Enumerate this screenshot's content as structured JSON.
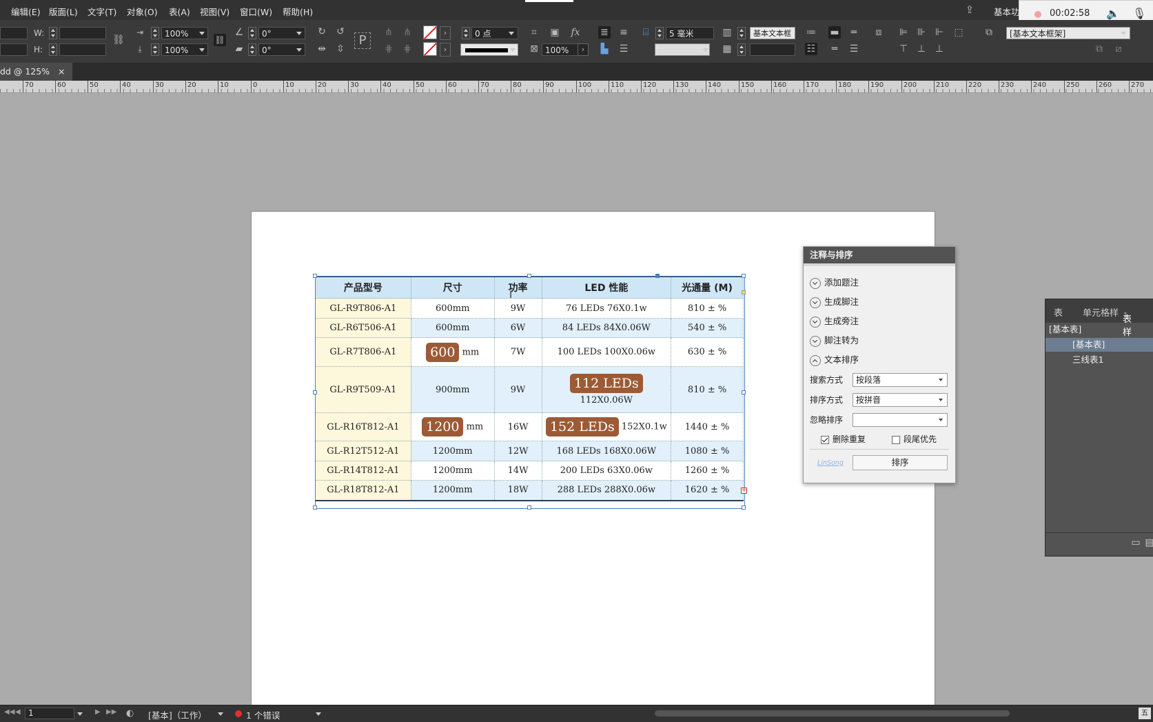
{
  "menu": [
    "编辑(E)",
    "版面(L)",
    "文字(T)",
    "对象(O)",
    "表(A)",
    "视图(V)",
    "窗口(W)",
    "帮助(H)"
  ],
  "workspace_label": "基本功",
  "recorder": {
    "time": "00:02:58"
  },
  "control": {
    "w_label": "W:",
    "h_label": "H:",
    "scale_x": "100%",
    "scale_y": "100%",
    "rotate": "0°",
    "shear": "0°",
    "stroke_weight": "0 点",
    "opacity": "100%",
    "inset": "5 毫米",
    "para_style": "基本文本框",
    "object_style": "[基本文本框架]"
  },
  "document_tab": {
    "title": "dd @ 125%",
    "close": "×"
  },
  "ruler_ticks": [
    "70",
    "60",
    "50",
    "40",
    "30",
    "20",
    "10",
    "0",
    "10",
    "20",
    "30",
    "40",
    "50",
    "60",
    "70",
    "80",
    "90",
    "100",
    "110",
    "120",
    "130",
    "140",
    "150",
    "160",
    "170",
    "180",
    "190",
    "200",
    "210",
    "220",
    "230",
    "240",
    "250",
    "260",
    "270"
  ],
  "table": {
    "headers": [
      "产品型号",
      "尺寸",
      "功率",
      "LED 性能",
      "光通量 (M)"
    ],
    "rows": [
      {
        "model": "GL-R9T806-A1",
        "size": "600mm",
        "power": "9W",
        "led": "76 LEDs 76X0.1w",
        "lumen": "810 ± %"
      },
      {
        "model": "GL-R6T506-A1",
        "size": "600mm",
        "power": "6W",
        "led": "84 LEDs 84X0.06W",
        "lumen": "540 ± %"
      },
      {
        "model": "GL-R7T806-A1",
        "size_hl": "600",
        "size_unit": "mm",
        "power": "7W",
        "led": "100 LEDs 100X0.06w",
        "lumen": "630 ± %"
      },
      {
        "model": "GL-R9T509-A1",
        "size": "900mm",
        "power": "9W",
        "led_hl": "112 LEDs",
        "led_sub": "112X0.06W",
        "lumen": "810 ± %"
      },
      {
        "model": "GL-R16T812-A1",
        "size_hl": "1200",
        "size_unit": "mm",
        "power": "16W",
        "led_hl": "152 LEDs",
        "led_sub": "152X0.1w",
        "lumen": "1440 ± %"
      },
      {
        "model": "GL-R12T512-A1",
        "size": "1200mm",
        "power": "12W",
        "led": "168 LEDs 168X0.06W",
        "lumen": "1080 ± %"
      },
      {
        "model": "GL-R14T812-A1",
        "size": "1200mm",
        "power": "14W",
        "led": "200 LEDs 63X0.06w",
        "lumen": "1260 ± %"
      },
      {
        "model": "GL-R18T812-A1",
        "size": "1200mm",
        "power": "18W",
        "led": "288 LEDs 288X0.06w",
        "lumen": "1620 ± %"
      }
    ]
  },
  "notes_panel": {
    "title": "注释与排序",
    "actions": [
      "添加题注",
      "生成脚注",
      "生成旁注",
      "脚注转为",
      "文本排序"
    ],
    "search_label": "搜索方式",
    "search_value": "按段落",
    "sort_label": "排序方式",
    "sort_value": "按拼音",
    "ignore_label": "忽略排序",
    "ignore_value": "",
    "dedupe_label": "删除重复",
    "tail_label": "段尾优先",
    "brand": "LinSong",
    "sort_button": "排序"
  },
  "styles_panel": {
    "tabs": [
      "表",
      "单元格样",
      "表样式"
    ],
    "items": [
      "[基本表]",
      "[基本表]",
      "三线表1"
    ]
  },
  "status": {
    "page": "1",
    "profile": "[基本]（工作）",
    "errors": "1 个错误"
  }
}
